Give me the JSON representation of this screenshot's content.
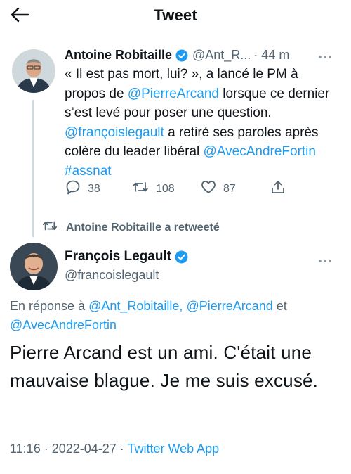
{
  "header": {
    "title": "Tweet"
  },
  "quoted_tweet": {
    "author_name": "Antoine Robitaille",
    "author_handle": "@Ant_R...",
    "time": "· 44 m",
    "text_segments": [
      {
        "text": "« Il est pas mort, lui? », a lancé le PM à propos de ",
        "type": "text"
      },
      {
        "text": "@PierreArcand",
        "type": "mention"
      },
      {
        "text": " lorsque ce dernier s’est levé pour poser une question. ",
        "type": "text"
      },
      {
        "text": "@françoislegault",
        "type": "mention"
      },
      {
        "text": " a retiré ses paroles après colère du leader libéral ",
        "type": "text"
      },
      {
        "text": "@AvecAndreFortin",
        "type": "mention"
      },
      {
        "text": " ",
        "type": "text"
      },
      {
        "text": "#assnat",
        "type": "hashtag"
      }
    ],
    "replies": "38",
    "retweets": "108",
    "likes": "87"
  },
  "retweet_banner": "Antoine Robitaille a retweeté",
  "main_tweet": {
    "author_name": "François Legault",
    "author_handle": "@francoislegault",
    "reply_prefix": "En réponse à ",
    "reply_mention_1": "@Ant_Robitaille,",
    "reply_mention_2": "@PierreArcand",
    "reply_conjunction": " et ",
    "reply_mention_3": "@AvecAndreFortin",
    "text": "Pierre Arcand est un ami. C'était une mauvaise blague. Je me suis excusé.",
    "time": "11:16 · 2022-04-27 · ",
    "source": "Twitter Web App"
  },
  "colors": {
    "accent": "#1d9bf0",
    "secondary_text": "#536471",
    "primary_text": "#0f1419",
    "verified": "#1d9bf0"
  },
  "icons": [
    "back-arrow-icon",
    "verified-badge-icon",
    "more-options-icon",
    "reply-icon",
    "retweet-icon",
    "like-icon",
    "share-icon"
  ]
}
